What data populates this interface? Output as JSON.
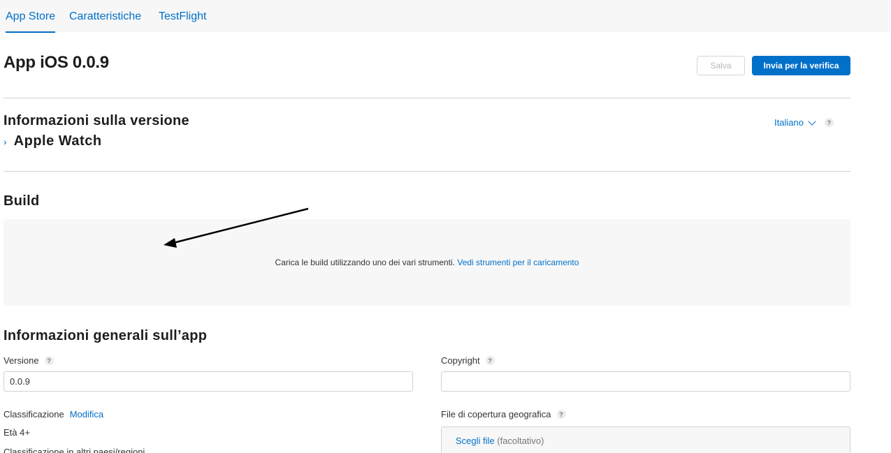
{
  "tabs": [
    {
      "label": "App Store"
    },
    {
      "label": "Caratteristiche"
    },
    {
      "label": "TestFlight"
    }
  ],
  "page": {
    "title": "App iOS 0.0.9",
    "save_label": "Salva",
    "submit_label": "Invia per la verifica"
  },
  "version_info": {
    "title": "Informazioni sulla versione",
    "language": "Italiano",
    "help": "?",
    "apple_watch_label": "Apple Watch"
  },
  "build": {
    "title": "Build",
    "message": "Carica le build utilizzando uno dei vari strumenti.",
    "link": "Vedi strumenti per il caricamento"
  },
  "general": {
    "title": "Informazioni generali sull’app",
    "version_label": "Versione",
    "version_value": "0.0.9",
    "copyright_label": "Copyright",
    "copyright_value": "",
    "rating_label": "Classificazione",
    "rating_edit": "Modifica",
    "rating_value": "Età 4+",
    "rating_other": "Classificazione in altri paesi/regioni",
    "geo_label": "File di copertura geografica",
    "geo_choose": "Scegli file",
    "geo_optional": "(facoltativo)",
    "help": "?"
  },
  "colors": {
    "accent": "#0070c9",
    "nav_bg": "#f7f7f7",
    "box_bg": "#f7f7f7",
    "divider": "#d2d2d2"
  }
}
